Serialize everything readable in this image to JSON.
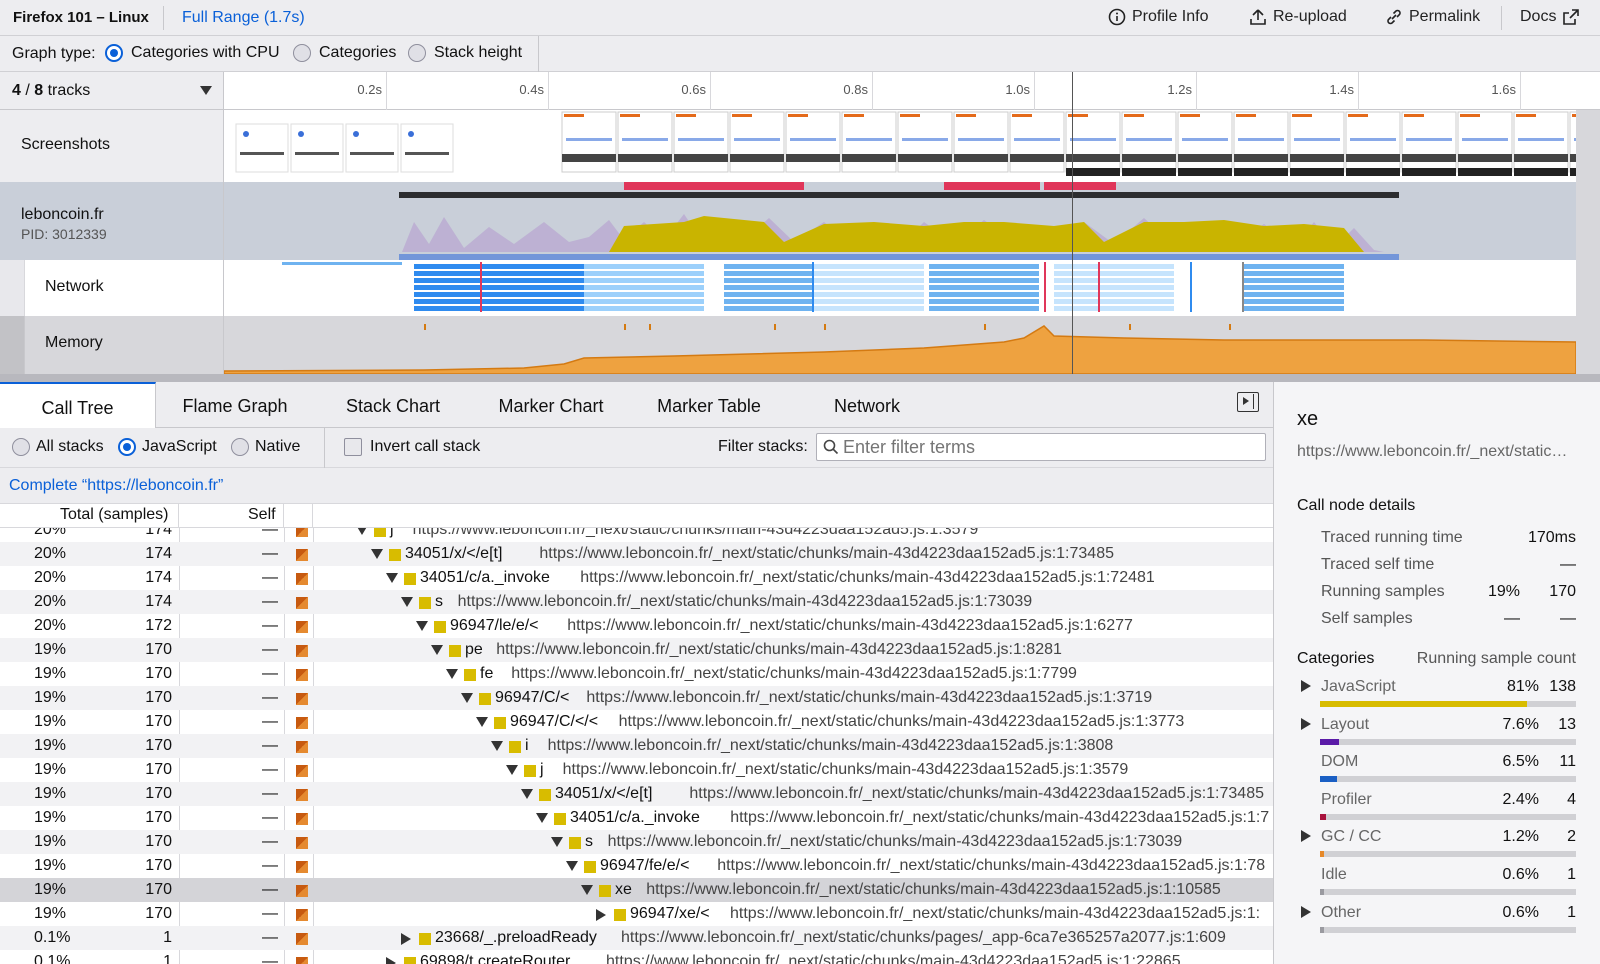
{
  "topbar": {
    "title": "Firefox 101 – Linux",
    "range": "Full Range (1.7s)",
    "profile_info": "Profile Info",
    "reupload": "Re-upload",
    "permalink": "Permalink",
    "docs": "Docs"
  },
  "graph_type": {
    "label": "Graph type:",
    "options": [
      "Categories with CPU",
      "Categories",
      "Stack height"
    ],
    "selected": "Categories with CPU"
  },
  "timeline": {
    "track_count_current": "4",
    "track_count_sep": " / ",
    "track_count_total": "8",
    "track_count_suffix": "tracks",
    "ticks": [
      "0.2s",
      "0.4s",
      "0.6s",
      "0.8s",
      "1.0s",
      "1.2s",
      "1.4s",
      "1.6s"
    ],
    "tracks": {
      "screenshots": "Screenshots",
      "process_name": "leboncoin.fr",
      "process_pid": "PID: 3012339",
      "network": "Network",
      "memory": "Memory"
    }
  },
  "panel_tabs": [
    "Call Tree",
    "Flame Graph",
    "Stack Chart",
    "Marker Chart",
    "Marker Table",
    "Network"
  ],
  "selected_tab": "Call Tree",
  "call_tree_options": {
    "stack_options": [
      "All stacks",
      "JavaScript",
      "Native"
    ],
    "selected_stack": "JavaScript",
    "invert": "Invert call stack",
    "filter_label": "Filter stacks:",
    "filter_placeholder": "Enter filter terms"
  },
  "breadcrumb": "Complete “https://leboncoin.fr”",
  "columns": {
    "total": "Total (samples)",
    "self": "Self"
  },
  "rows": [
    {
      "pct": "20%",
      "total": "174",
      "self": "—",
      "name": "j",
      "url": "https://www.leboncoin.fr/_next/static/chunks/main-43d4223daa152ad5.js:1:3579",
      "depth": 0,
      "partial": true
    },
    {
      "pct": "20%",
      "total": "174",
      "self": "—",
      "name": "34051/x/</e[t]",
      "url": "https://www.leboncoin.fr/_next/static/chunks/main-43d4223daa152ad5.js:1:73485",
      "depth": 1
    },
    {
      "pct": "20%",
      "total": "174",
      "self": "—",
      "name": "34051/c/a._invoke",
      "url": "https://www.leboncoin.fr/_next/static/chunks/main-43d4223daa152ad5.js:1:72481",
      "depth": 2
    },
    {
      "pct": "20%",
      "total": "174",
      "self": "—",
      "name": "s",
      "url": "https://www.leboncoin.fr/_next/static/chunks/main-43d4223daa152ad5.js:1:73039",
      "depth": 3
    },
    {
      "pct": "20%",
      "total": "172",
      "self": "—",
      "name": "96947/le/e/<",
      "url": "https://www.leboncoin.fr/_next/static/chunks/main-43d4223daa152ad5.js:1:6277",
      "depth": 4
    },
    {
      "pct": "19%",
      "total": "170",
      "self": "—",
      "name": "pe",
      "url": "https://www.leboncoin.fr/_next/static/chunks/main-43d4223daa152ad5.js:1:8281",
      "depth": 5
    },
    {
      "pct": "19%",
      "total": "170",
      "self": "—",
      "name": "fe",
      "url": "https://www.leboncoin.fr/_next/static/chunks/main-43d4223daa152ad5.js:1:7799",
      "depth": 6
    },
    {
      "pct": "19%",
      "total": "170",
      "self": "—",
      "name": "96947/C/<",
      "url": "https://www.leboncoin.fr/_next/static/chunks/main-43d4223daa152ad5.js:1:3719",
      "depth": 7
    },
    {
      "pct": "19%",
      "total": "170",
      "self": "—",
      "name": "96947/C/</<",
      "url": "https://www.leboncoin.fr/_next/static/chunks/main-43d4223daa152ad5.js:1:3773",
      "depth": 8
    },
    {
      "pct": "19%",
      "total": "170",
      "self": "—",
      "name": "i",
      "url": "https://www.leboncoin.fr/_next/static/chunks/main-43d4223daa152ad5.js:1:3808",
      "depth": 9
    },
    {
      "pct": "19%",
      "total": "170",
      "self": "—",
      "name": "j",
      "url": "https://www.leboncoin.fr/_next/static/chunks/main-43d4223daa152ad5.js:1:3579",
      "depth": 10
    },
    {
      "pct": "19%",
      "total": "170",
      "self": "—",
      "name": "34051/x/</e[t]",
      "url": "https://www.leboncoin.fr/_next/static/chunks/main-43d4223daa152ad5.js:1:73485",
      "depth": 11
    },
    {
      "pct": "19%",
      "total": "170",
      "self": "—",
      "name": "34051/c/a._invoke",
      "url": "https://www.leboncoin.fr/_next/static/chunks/main-43d4223daa152ad5.js:1:7",
      "depth": 12
    },
    {
      "pct": "19%",
      "total": "170",
      "self": "—",
      "name": "s",
      "url": "https://www.leboncoin.fr/_next/static/chunks/main-43d4223daa152ad5.js:1:73039",
      "depth": 13
    },
    {
      "pct": "19%",
      "total": "170",
      "self": "—",
      "name": "96947/fe/e/<",
      "url": "https://www.leboncoin.fr/_next/static/chunks/main-43d4223daa152ad5.js:1:78",
      "depth": 14
    },
    {
      "pct": "19%",
      "total": "170",
      "self": "—",
      "name": "xe",
      "url": "https://www.leboncoin.fr/_next/static/chunks/main-43d4223daa152ad5.js:1:10585",
      "depth": 15,
      "selected": true
    },
    {
      "pct": "19%",
      "total": "170",
      "self": "—",
      "name": "96947/xe/<",
      "url": "https://www.leboncoin.fr/_next/static/chunks/main-43d4223daa152ad5.js:1:",
      "depth": 16,
      "collapsed": true
    },
    {
      "pct": "0.1%",
      "total": "1",
      "self": "—",
      "name": "23668/_.preloadReady",
      "url": "https://www.leboncoin.fr/_next/static/chunks/pages/_app-6ca7e365257a2077.js:1:609",
      "depth": 3,
      "collapsed": true
    },
    {
      "pct": "0.1%",
      "total": "1",
      "self": "—",
      "name": "69898/t.createRouter",
      "url": "https://www.leboncoin.fr/_next/static/chunks/main-43d4223daa152ad5.js:1:22865",
      "depth": 2,
      "collapsed": true,
      "partial": true
    }
  ],
  "sidebar": {
    "title": "xe",
    "url": "https://www.leboncoin.fr/_next/static…",
    "details_header": "Call node details",
    "details": [
      {
        "label": "Traced running time",
        "pct": "",
        "value": "170ms"
      },
      {
        "label": "Traced self time",
        "pct": "",
        "value": "—"
      },
      {
        "label": "Running samples",
        "pct": "19%",
        "value": "170"
      },
      {
        "label": "Self samples",
        "pct": "—",
        "value": "—"
      }
    ],
    "categories_header": "Categories",
    "categories_count_header": "Running sample count",
    "categories": [
      {
        "name": "JavaScript",
        "pct": "81%",
        "count": "138",
        "fraction": 0.81,
        "color": "#d8bc00",
        "expandable": true
      },
      {
        "name": "Layout",
        "pct": "7.6%",
        "count": "13",
        "fraction": 0.076,
        "color": "#5b1ba8",
        "expandable": true
      },
      {
        "name": "DOM",
        "pct": "6.5%",
        "count": "11",
        "fraction": 0.065,
        "color": "#1a5fc4",
        "expandable": false
      },
      {
        "name": "Profiler",
        "pct": "2.4%",
        "count": "4",
        "fraction": 0.024,
        "color": "#a8123d",
        "expandable": false
      },
      {
        "name": "GC / CC",
        "pct": "1.2%",
        "count": "2",
        "fraction": 0.012,
        "color": "#e6892a",
        "expandable": true
      },
      {
        "name": "Idle",
        "pct": "0.6%",
        "count": "1",
        "fraction": 0.006,
        "color": "#9a9aa0",
        "expandable": false
      },
      {
        "name": "Other",
        "pct": "0.6%",
        "count": "1",
        "fraction": 0.006,
        "color": "#9a9aa0",
        "expandable": true
      }
    ]
  }
}
